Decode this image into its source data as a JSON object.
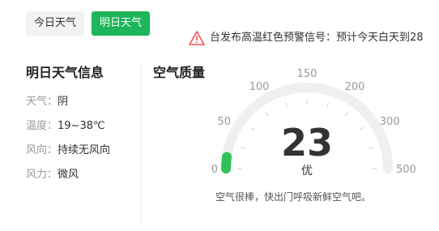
{
  "tabs": {
    "today": "今日天气",
    "tomorrow": "明日天气"
  },
  "alert": {
    "icon": "warning-triangle-icon",
    "text": "台发布高温红色预警信号：预计今天白天到28"
  },
  "tomorrow": {
    "title": "明日天气信息",
    "rows": [
      {
        "label": "天气：",
        "value": "阴"
      },
      {
        "label": "温度：",
        "value": "19~38℃"
      },
      {
        "label": "风向：",
        "value": "持续无风向"
      },
      {
        "label": "风力：",
        "value": "微风"
      }
    ]
  },
  "aqi": {
    "title": "空气质量",
    "value": "23",
    "level": "优",
    "tip": "空气很棒，快出门呼吸新鲜空气吧。",
    "scale_labels": [
      "0",
      "50",
      "100",
      "150",
      "200",
      "300",
      "500"
    ],
    "fraction": 0.046,
    "colors": {
      "track": "#efefef",
      "fill": "#2fc25b",
      "accent": "#1fb55a",
      "warning": "#e85550"
    }
  }
}
